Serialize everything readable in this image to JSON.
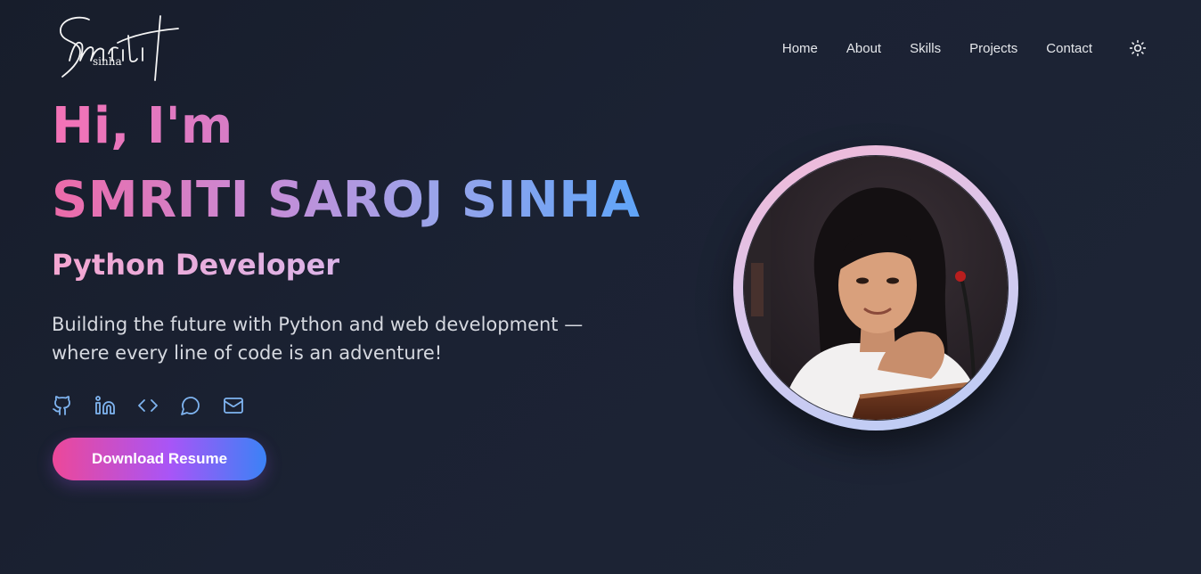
{
  "brand": {
    "logo_script": "Smriti",
    "logo_sub": "sinha"
  },
  "nav": {
    "items": [
      "Home",
      "About",
      "Skills",
      "Projects",
      "Contact"
    ],
    "theme_icon": "sun-icon"
  },
  "hero": {
    "greeting": "Hi, I'm",
    "name": "SMRITI SAROJ SINHA",
    "role": "Python Developer",
    "tagline": "Building the future with Python and web development — where every line of code is an adventure!",
    "socials": [
      "github-icon",
      "linkedin-icon",
      "code-icon",
      "chat-icon",
      "mail-icon"
    ],
    "cta_label": "Download Resume"
  },
  "colors": {
    "background": "#1b2233",
    "accent_pink": "#ec4899",
    "accent_purple": "#a855f7",
    "accent_blue": "#3b82f6",
    "icon_blue": "#7fb4f0"
  }
}
